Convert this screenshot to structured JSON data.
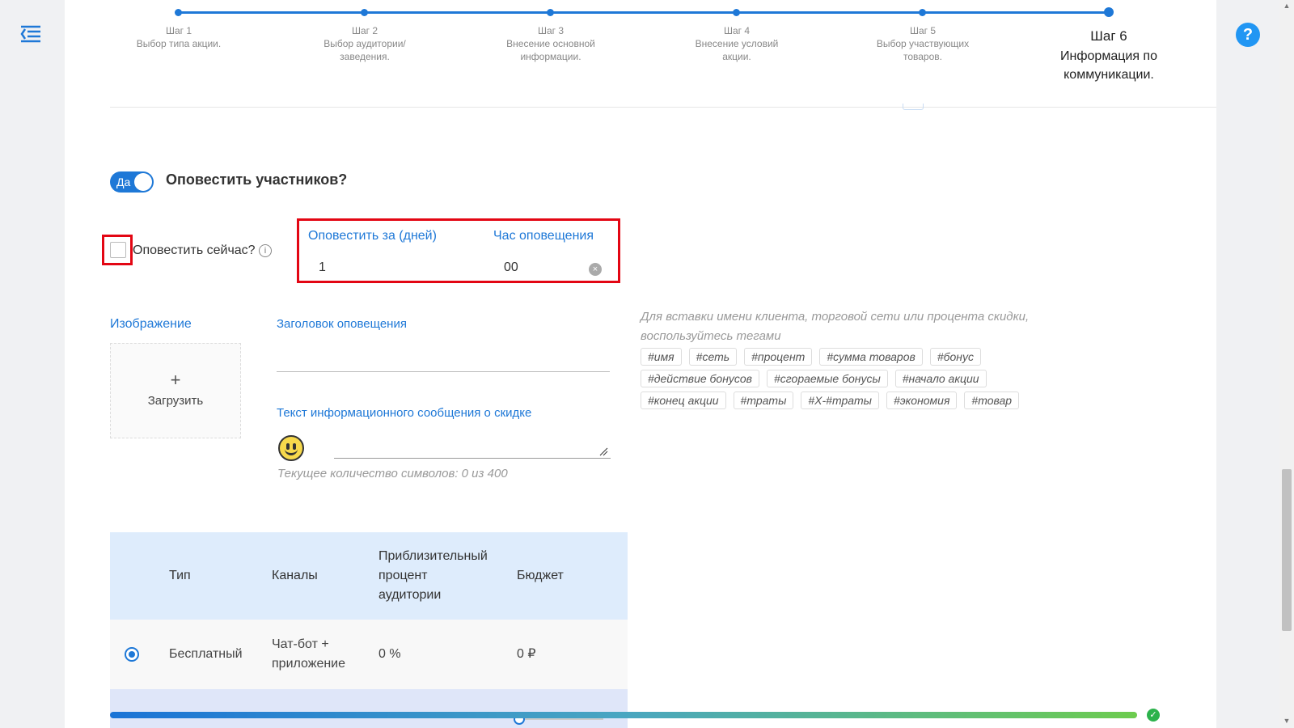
{
  "nav": {
    "menu_icon": "menu-collapse-icon",
    "help_label": "?"
  },
  "stepper": {
    "steps": [
      {
        "title": "Шаг 1",
        "desc": "Выбор типа акции."
      },
      {
        "title": "Шаг 2",
        "desc": "Выбор аудитории/заведения."
      },
      {
        "title": "Шаг 3",
        "desc": "Внесение основной информации."
      },
      {
        "title": "Шаг 4",
        "desc": "Внесение условий акции."
      },
      {
        "title": "Шаг 5",
        "desc": "Выбор участвующих товаров."
      },
      {
        "title": "Шаг 6",
        "desc": "Информация по коммуникации."
      }
    ],
    "active_step": 6
  },
  "notify": {
    "toggle_label": "Да",
    "toggle_on": true,
    "title": "Оповестить участников?",
    "notify_now_label": "Оповестить сейчас?",
    "notify_now_checked": false,
    "info_icon": "i",
    "days_label": "Оповестить за (дней)",
    "days_value": "1",
    "hour_label": "Час оповещения",
    "hour_value": "00",
    "clear_icon": "×"
  },
  "content": {
    "image_label": "Изображение",
    "upload_plus": "+",
    "upload_label": "Загрузить",
    "title_label": "Заголовок оповещения",
    "title_value": "",
    "message_label": "Текст информационного сообщения о скидке",
    "message_value": "",
    "char_count": "Текущее количество символов: 0 из 400",
    "tags_hint": "Для вставки имени клиента, торговой сети или процента скидки, воспользуйтесь тегами",
    "tag_rows": [
      [
        "#имя",
        "#сеть",
        "#процент",
        "#сумма товаров",
        "#бонус"
      ],
      [
        "#действие бонусов",
        "#сгораемые бонусы",
        "#начало акции"
      ],
      [
        "#конец акции",
        "#траты",
        "#X-#траты",
        "#экономия",
        "#товар"
      ]
    ]
  },
  "table": {
    "headers": {
      "type": "Тип",
      "channels": "Каналы",
      "audience_l1": "Приблизительный",
      "audience_l2": "процент",
      "audience_l3": "аудитории",
      "budget": "Бюджет"
    },
    "rows": [
      {
        "selected": true,
        "type": "Бесплатный",
        "channels_l1": "Чат-бот +",
        "channels_l2": "приложение",
        "audience": "0 %",
        "budget": "0 ₽"
      }
    ]
  },
  "progress": {
    "percent": 100,
    "complete_icon": "✓"
  },
  "colors": {
    "accent": "#1e78d7",
    "highlight": "#e30613",
    "success": "#2cb24c"
  }
}
